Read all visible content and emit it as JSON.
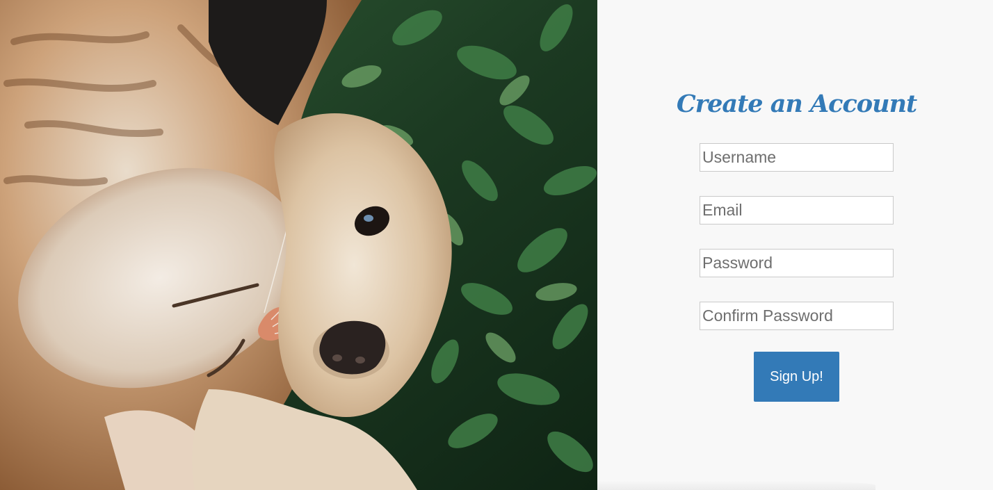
{
  "hero_image": {
    "subject": "cat-and-dog-photo"
  },
  "signup_form": {
    "title": "Create an Account",
    "fields": {
      "username": {
        "placeholder": "Username",
        "value": ""
      },
      "email": {
        "placeholder": "Email",
        "value": ""
      },
      "password": {
        "placeholder": "Password",
        "value": ""
      },
      "confirm_password": {
        "placeholder": "Confirm Password",
        "value": ""
      }
    },
    "submit_label": "Sign Up!"
  },
  "colors": {
    "accent": "#337ab7",
    "panel_background": "#f8f8f8",
    "input_border": "#c9c9c9"
  }
}
